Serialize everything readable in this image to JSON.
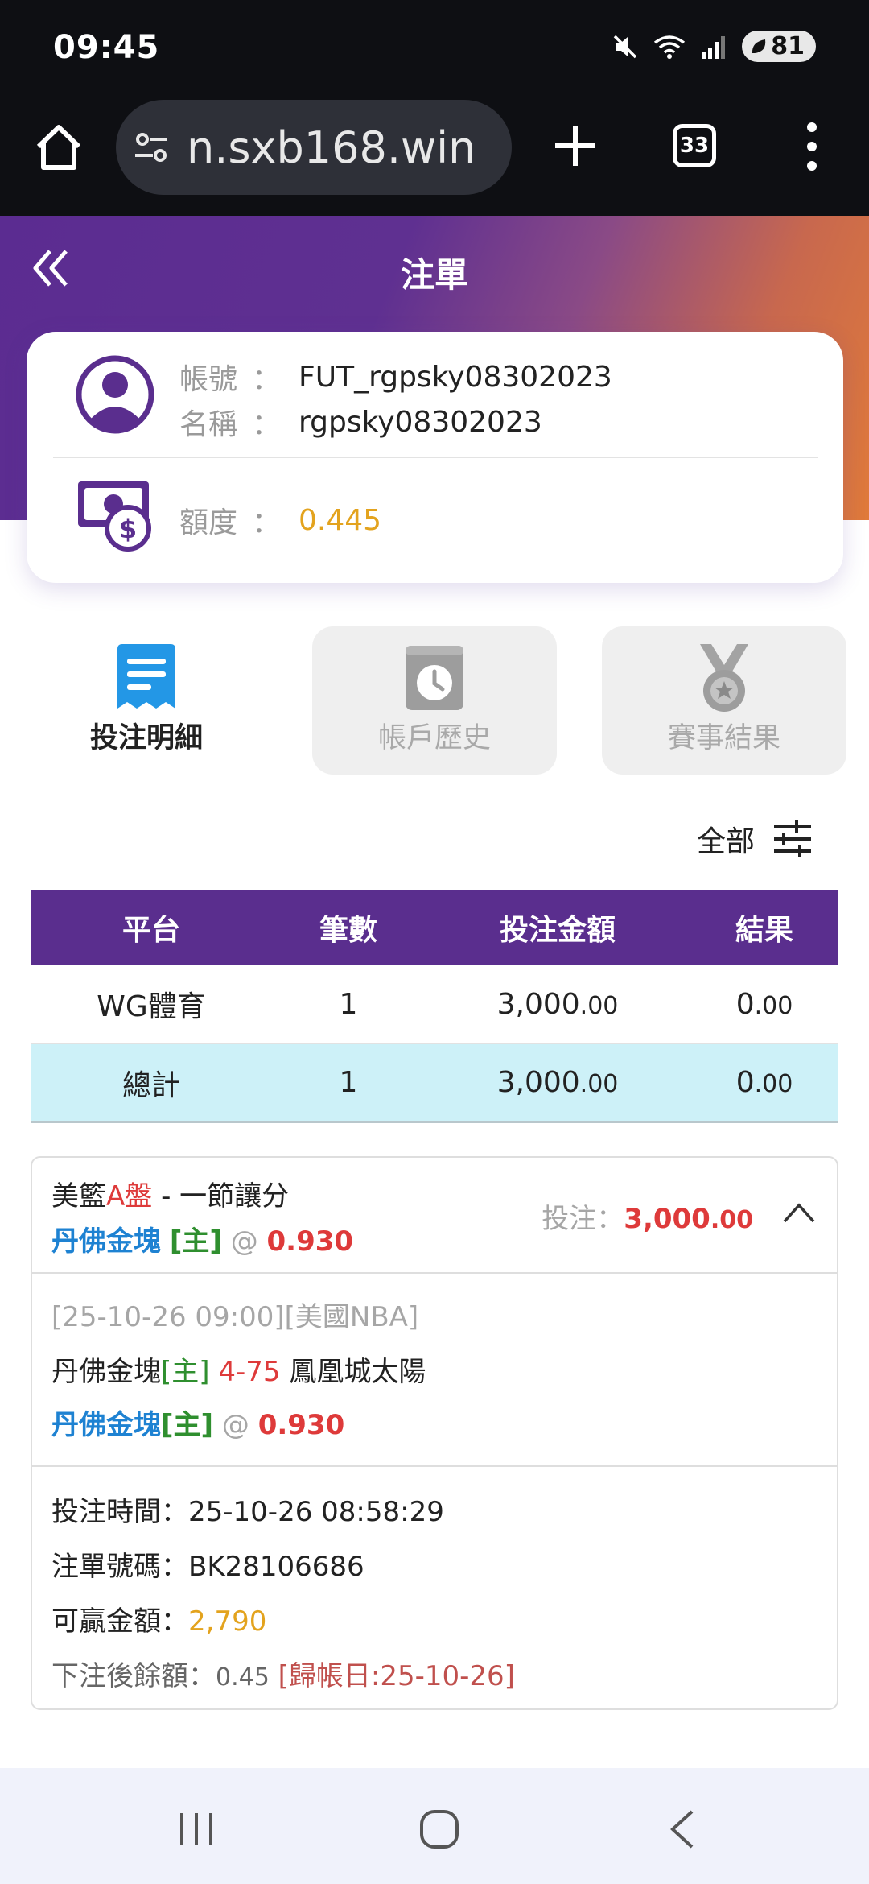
{
  "status_bar": {
    "time": "09:45",
    "battery": "81",
    "icons": [
      "mute-icon",
      "wifi-icon",
      "signal-icon"
    ]
  },
  "browser": {
    "url": "n.sxb168.win",
    "tab_count": "33"
  },
  "header": {
    "title": "注單"
  },
  "account": {
    "id_label": "帳號",
    "id_value": "FUT_rgpsky08302023",
    "name_label": "名稱",
    "name_value": "rgpsky08302023",
    "quota_label": "額度",
    "quota_value": "0.445",
    "colon": "："
  },
  "tabs": [
    {
      "label": "投注明細",
      "active": true
    },
    {
      "label": "帳戶歷史",
      "active": false
    },
    {
      "label": "賽事結果",
      "active": false
    }
  ],
  "filter": {
    "label": "全部"
  },
  "summary": {
    "headers": [
      "平台",
      "筆數",
      "投注金額",
      "結果"
    ],
    "rows": [
      {
        "platform": "WG體育",
        "count": "1",
        "amount_int": "3,000",
        "amount_dec": ".00",
        "result_int": "0",
        "result_dec": ".00"
      }
    ],
    "total": {
      "platform": "總計",
      "count": "1",
      "amount_int": "3,000",
      "amount_dec": ".00",
      "result_int": "0",
      "result_dec": ".00"
    }
  },
  "bet": {
    "market_prefix": "美籃",
    "market_highlight": "A盤",
    "market_suffix": " - 一節讓分",
    "pick_team": "丹佛金塊",
    "pick_side": "[主]",
    "at": "@",
    "odds": "0.930",
    "stake_label": "投注：",
    "stake_int": "3,000",
    "stake_dec": ".00",
    "event_info": "[25-10-26 09:00][美國NBA]",
    "home_team": "丹佛金塊",
    "home_side": "[主]",
    "line": "4-75",
    "away_team": "鳳凰城太陽",
    "bet_time_label": "投注時間：",
    "bet_time": "25-10-26 08:58:29",
    "ticket_label": "注單號碼：",
    "ticket_no": "BK28106686",
    "win_label": "可贏金額：",
    "win_amount": "2,790",
    "balance_label": "下注後餘額：",
    "balance": "0.45",
    "settle": "[歸帳日:25-10-26]"
  },
  "colors": {
    "brand_purple": "#5a2e8e",
    "accent_orange": "#e07a3a",
    "gold": "#e3a31e",
    "red": "#de3a3a",
    "blue": "#1e82d2",
    "green": "#2f8f2f",
    "total_row": "#cdf1f8"
  }
}
